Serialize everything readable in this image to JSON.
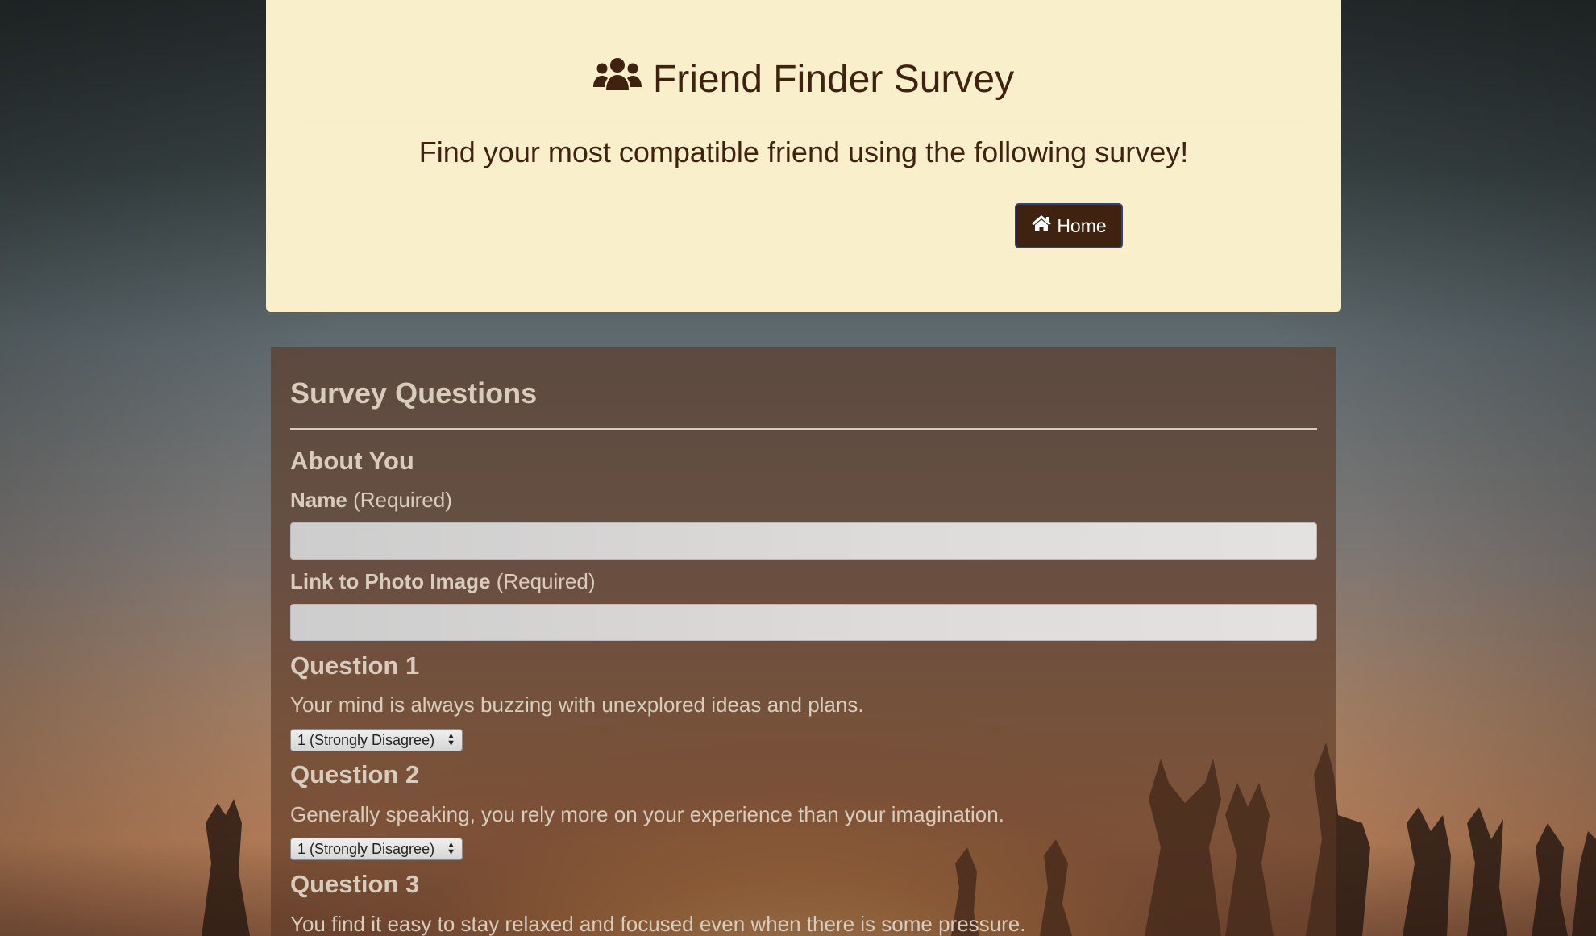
{
  "header": {
    "title": "Friend Finder Survey",
    "lead": "Find your most compatible friend using the following survey!",
    "home_button": "Home"
  },
  "survey": {
    "heading": "Survey Questions",
    "about_heading": "About You",
    "name_label": "Name",
    "name_required": "(Required)",
    "name_value": "",
    "photo_label": "Link to Photo Image",
    "photo_required": "(Required)",
    "photo_value": "",
    "questions": [
      {
        "title": "Question 1",
        "text": "Your mind is always buzzing with unexplored ideas and plans.",
        "selected": "1 (Strongly Disagree)"
      },
      {
        "title": "Question 2",
        "text": "Generally speaking, you rely more on your experience than your imagination.",
        "selected": "1 (Strongly Disagree)"
      },
      {
        "title": "Question 3",
        "text": "You find it easy to stay relaxed and focused even when there is some pressure."
      }
    ]
  },
  "icons": {
    "title_icon": "users-icon",
    "home_icon": "home-icon",
    "select_arrows": "chevron-up-down-icon"
  },
  "colors": {
    "jumbotron_bg": "#f9efcb",
    "title_text": "#3f220f",
    "button_bg": "#3f220f",
    "panel_bg": "rgba(90,55,35,0.62)",
    "panel_text": "#d9ccbd"
  }
}
